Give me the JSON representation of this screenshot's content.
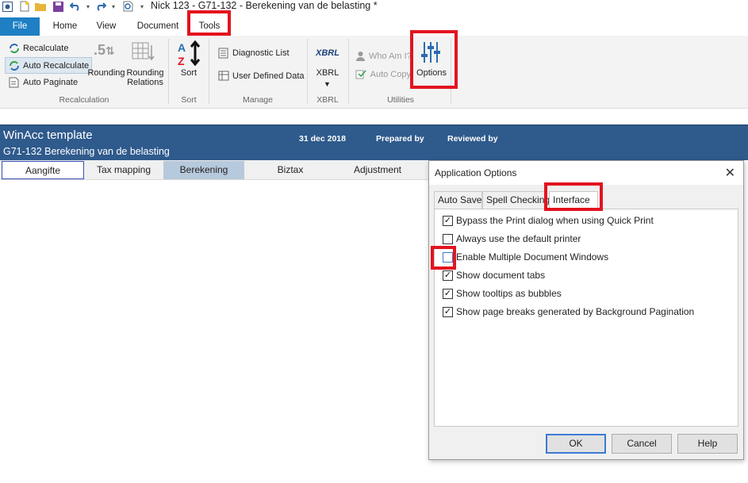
{
  "titlebar": {
    "title": "Nick 123 - G71-132 - Berekening van de belasting *",
    "quick_access": [
      "app-icon",
      "new-icon",
      "open-icon",
      "save-icon",
      "undo-icon",
      "redo-icon",
      "preview-icon"
    ]
  },
  "ribbon_tabs": {
    "file": "File",
    "home": "Home",
    "view": "View",
    "document": "Document",
    "tools": "Tools"
  },
  "ribbon": {
    "recalculate": "Recalculate",
    "auto_recalculate": "Auto Recalculate",
    "auto_paginate": "Auto Paginate",
    "rounding": "Rounding",
    "rounding_relations": "Rounding Relations",
    "rounding_relations_l1": "Rounding",
    "rounding_relations_l2": "Relations",
    "group_recalculation": "Recalculation",
    "sort": "Sort",
    "group_sort": "Sort",
    "diagnostic_list": "Diagnostic List",
    "user_defined_data": "User Defined Data",
    "group_manage": "Manage",
    "xbrl_logo": "XBRL",
    "xbrl": "XBRL",
    "group_xbrl": "XBRL",
    "who_am_i": "Who Am I?",
    "auto_copy": "Auto Copy",
    "options": "Options",
    "group_utilities": "Utilities",
    "rounding_glyph": ".5"
  },
  "doc": {
    "title": "WinAcc template",
    "subtitle": "G71-132 Berekening van de belasting",
    "date": "31 dec 2018",
    "prepared_by": "Prepared by",
    "reviewed_by": "Reviewed by",
    "tabs": [
      "Aangifte",
      "Tax mapping",
      "Berekening",
      "Biztax",
      "Adjustment"
    ]
  },
  "dialog": {
    "title": "Application Options",
    "close": "✕",
    "tabs": [
      "Auto Save",
      "Spell Checking",
      "Interface"
    ],
    "active_tab": "Interface",
    "options": [
      {
        "label": "Bypass the Print dialog when using Quick Print",
        "checked": true
      },
      {
        "label": "Always use the default printer",
        "checked": false
      },
      {
        "label": "Enable Multiple Document Windows",
        "checked": false
      },
      {
        "label": "Show document tabs",
        "checked": true
      },
      {
        "label": "Show tooltips as bubbles",
        "checked": true
      },
      {
        "label": "Show page breaks generated by Background Pagination",
        "checked": true
      }
    ],
    "buttons": {
      "ok": "OK",
      "cancel": "Cancel",
      "help": "Help"
    }
  },
  "colors": {
    "file_tab": "#1e7fc4",
    "doc_header": "#2f5a8c",
    "highlight": "#e3141f",
    "selected_doc_tab": "#b7c9dc"
  }
}
